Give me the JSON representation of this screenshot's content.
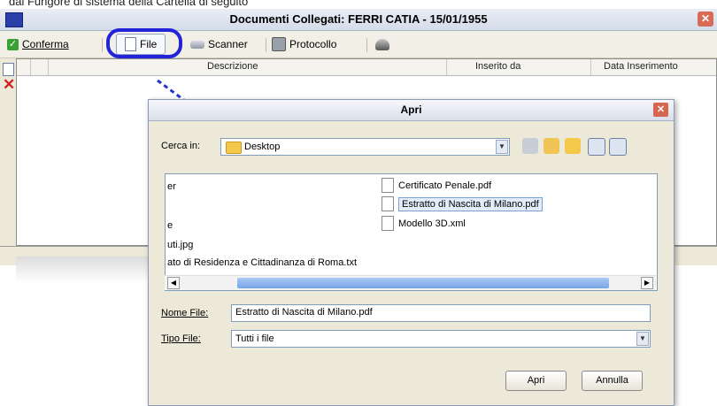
{
  "top_caption": "dal Fungore di sistema della Cartella di seguito",
  "main_window": {
    "title": "Documenti Collegati: FERRI CATIA - 15/01/1955",
    "toolbar": {
      "confirm": "Conferma",
      "file": "File",
      "scanner": "Scanner",
      "protocol": "Protocollo"
    },
    "grid_columns": [
      "Descrizione",
      "Inserito da",
      "Data Inserimento"
    ]
  },
  "dialog": {
    "title": "Apri",
    "look_in_label": "Cerca in:",
    "look_in_value": "Desktop",
    "files_left": [
      "er",
      "",
      "e",
      "uti.jpg",
      "ato di Residenza e Cittadinanza di Roma.txt"
    ],
    "files_right": [
      "Certificato Penale.pdf",
      "Estratto di Nascita di Milano.pdf",
      "Modello 3D.xml"
    ],
    "selected_file": "Estratto di Nascita di Milano.pdf",
    "filename_label": "Nome File:",
    "filename_value": "Estratto di Nascita di Milano.pdf",
    "filetype_label": "Tipo File:",
    "filetype_value": "Tutti i file",
    "open_button": "Apri",
    "cancel_button": "Annulla"
  },
  "colors": {
    "highlight": "#2323d9",
    "arrow": "#1f36c8",
    "delete_icon": "#cc2222",
    "confirm_check": "#3aa235"
  }
}
